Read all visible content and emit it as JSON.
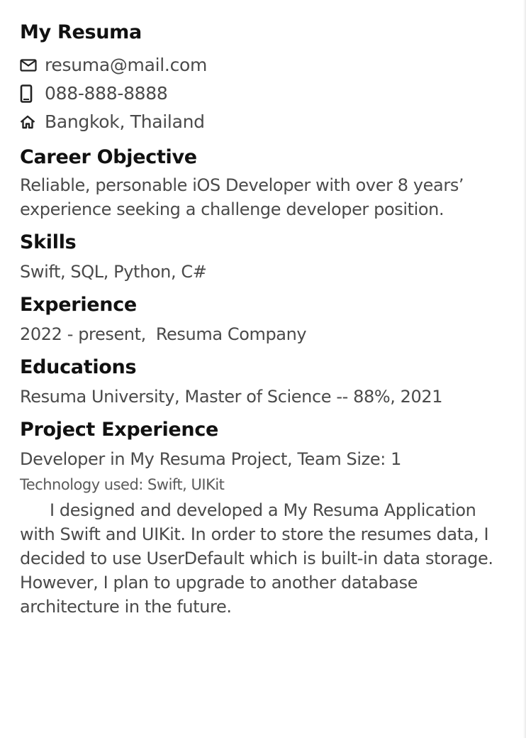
{
  "header": {
    "name": "My Resuma",
    "email": "resuma@mail.com",
    "phone": "088-888-8888",
    "address": "Bangkok, Thailand",
    "icons": [
      "mail-icon",
      "phone-icon",
      "home-icon"
    ]
  },
  "career_objective": {
    "title": "Career Objective",
    "text": "Reliable, personable iOS Developer with over 8 years’ experience seeking a challenge developer position."
  },
  "skills": {
    "title": "Skills",
    "text": "Swift, SQL, Python, C#"
  },
  "experience": {
    "title": "Experience",
    "period": "2022 - present,",
    "company": "Resuma Company"
  },
  "educations": {
    "title": "Educations",
    "text": "Resuma University, Master of Science -- 88%, 2021"
  },
  "project_experience": {
    "title": "Project Experience",
    "role": "Developer in My Resuma Project, Team Size: 1",
    "technology": "Technology used: Swift, UIKit",
    "description": "I designed and developed a My Resuma Application with Swift and UIKit. In order to store the resumes data, I decided to use UserDefault which is built-in data storage. However, I plan to upgrade to another database architecture in the future."
  }
}
